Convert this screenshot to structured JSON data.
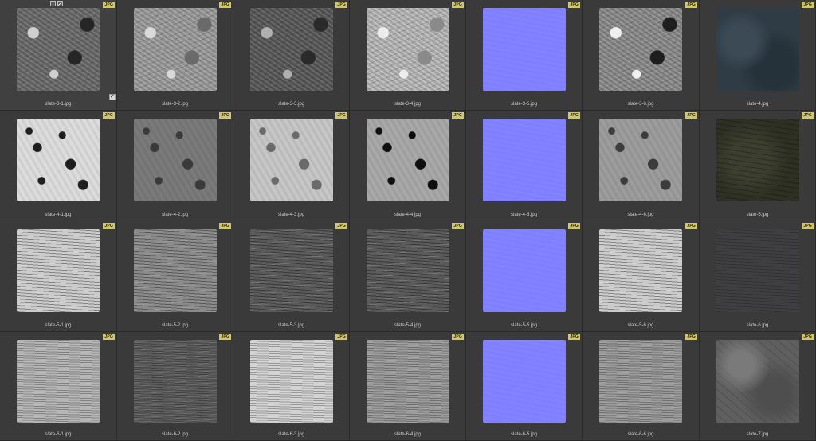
{
  "badge_text": "JPG",
  "files": [
    [
      {
        "name": "slate-3-1.jpg",
        "map": "diffuse"
      },
      {
        "name": "slate-3-2.jpg",
        "map": "roughness"
      },
      {
        "name": "slate-3-3.jpg",
        "map": "ao"
      },
      {
        "name": "slate-3-4.jpg",
        "map": "gloss"
      },
      {
        "name": "slate-3-5.jpg",
        "map": "normal"
      },
      {
        "name": "slate-3-6.jpg",
        "map": "displacement"
      },
      {
        "name": "slate-4.jpg",
        "map": "color-blue"
      }
    ],
    [
      {
        "name": "slate-4-1.jpg",
        "map": "bright-spotted"
      },
      {
        "name": "slate-4-2.jpg",
        "map": "dark-spotted"
      },
      {
        "name": "slate-4-3.jpg",
        "map": "light-spotted"
      },
      {
        "name": "slate-4-4.jpg",
        "map": "contrast-spotted"
      },
      {
        "name": "slate-4-5.jpg",
        "map": "normal"
      },
      {
        "name": "slate-4-6.jpg",
        "map": "mid-spotted"
      },
      {
        "name": "slate-5.jpg",
        "map": "color-green"
      }
    ],
    [
      {
        "name": "slate-5-1.jpg",
        "map": "layered-bright"
      },
      {
        "name": "slate-5-2.jpg",
        "map": "layered-grey"
      },
      {
        "name": "slate-5-3.jpg",
        "map": "layered-dark"
      },
      {
        "name": "slate-5-4.jpg",
        "map": "layered-dark"
      },
      {
        "name": "slate-5-5.jpg",
        "map": "normal"
      },
      {
        "name": "slate-5-6.jpg",
        "map": "layered-bright"
      },
      {
        "name": "slate-6.jpg",
        "map": "color-dark"
      }
    ],
    [
      {
        "name": "slate-6-1.jpg",
        "map": "wavy-light"
      },
      {
        "name": "slate-6-2.jpg",
        "map": "wavy-dark"
      },
      {
        "name": "slate-6-3.jpg",
        "map": "wavy-bright"
      },
      {
        "name": "slate-6-4.jpg",
        "map": "wavy-grey"
      },
      {
        "name": "slate-6-5.jpg",
        "map": "normal"
      },
      {
        "name": "slate-6-6.jpg",
        "map": "wavy-grey"
      },
      {
        "name": "slate-7.jpg",
        "map": "color-grey"
      }
    ]
  ],
  "selected": {
    "row": 0,
    "col": 0
  },
  "colors": {
    "background": "#2b2b2b",
    "cell": "#3a3a3a",
    "badge": "#cfc66e",
    "label": "#c9c9c9",
    "normal_map": "#8080ff"
  },
  "icons": {
    "select_tool_a": "square-select-icon",
    "select_tool_b": "slash-select-icon",
    "checkbox": "check-icon"
  }
}
